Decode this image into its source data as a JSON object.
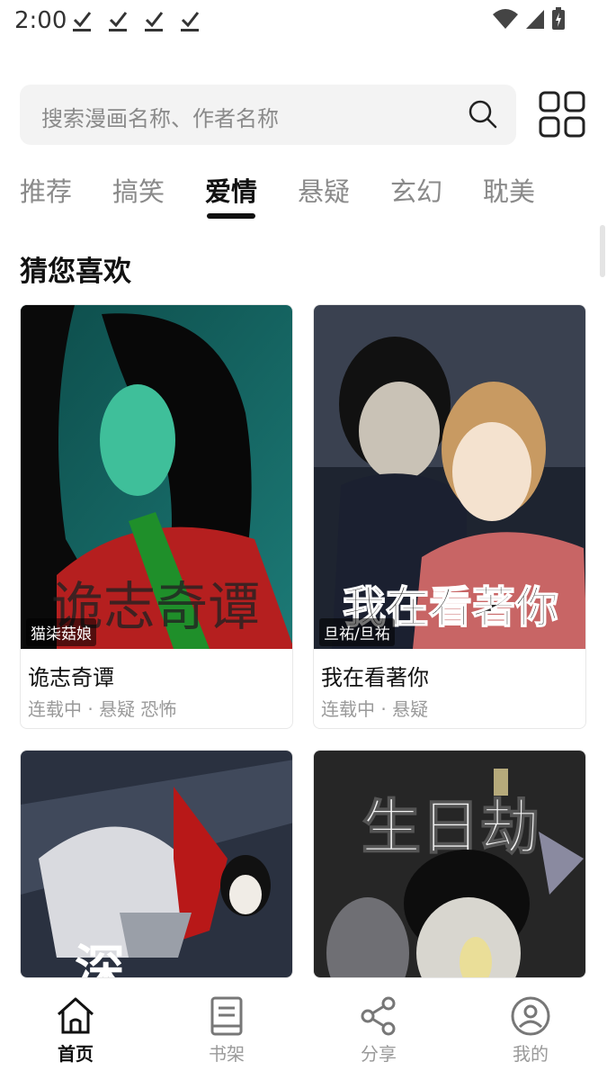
{
  "status_bar": {
    "time": "2:00",
    "icons": [
      "download-done-icon",
      "download-done-icon",
      "download-done-icon",
      "download-done-icon",
      "wifi-icon",
      "cell-signal-icon",
      "battery-charging-icon"
    ]
  },
  "search": {
    "placeholder": "搜索漫画名称、作者名称",
    "icon": "search-icon"
  },
  "grid_button_icon": "grid-icon",
  "tabs": [
    {
      "label": "推荐",
      "active": false
    },
    {
      "label": "搞笑",
      "active": false
    },
    {
      "label": "爱情",
      "active": true
    },
    {
      "label": "悬疑",
      "active": false
    },
    {
      "label": "玄幻",
      "active": false
    },
    {
      "label": "耽美",
      "active": false
    }
  ],
  "section": {
    "title": "猜您喜欢"
  },
  "comics": [
    {
      "title": "诡志奇谭",
      "author": "猫柒菇娘",
      "meta": "连载中 · 悬疑 恐怖",
      "cover_text": "诡志奇谭"
    },
    {
      "title": "我在看著你",
      "author": "旦祐/旦祐",
      "meta": "连载中 · 悬疑",
      "cover_text": "我在看著你"
    },
    {
      "title": "",
      "author": "",
      "meta": "",
      "cover_text": "深"
    },
    {
      "title": "",
      "author": "",
      "meta": "",
      "cover_text": "生日劫"
    }
  ],
  "bottom_nav": [
    {
      "label": "首页",
      "icon": "home-icon",
      "active": true
    },
    {
      "label": "书架",
      "icon": "bookshelf-icon",
      "active": false
    },
    {
      "label": "分享",
      "icon": "share-icon",
      "active": false
    },
    {
      "label": "我的",
      "icon": "profile-icon",
      "active": false
    }
  ],
  "colors": {
    "accent": "#111111",
    "muted": "#8a8a8a",
    "search_bg": "#f3f3f3"
  }
}
